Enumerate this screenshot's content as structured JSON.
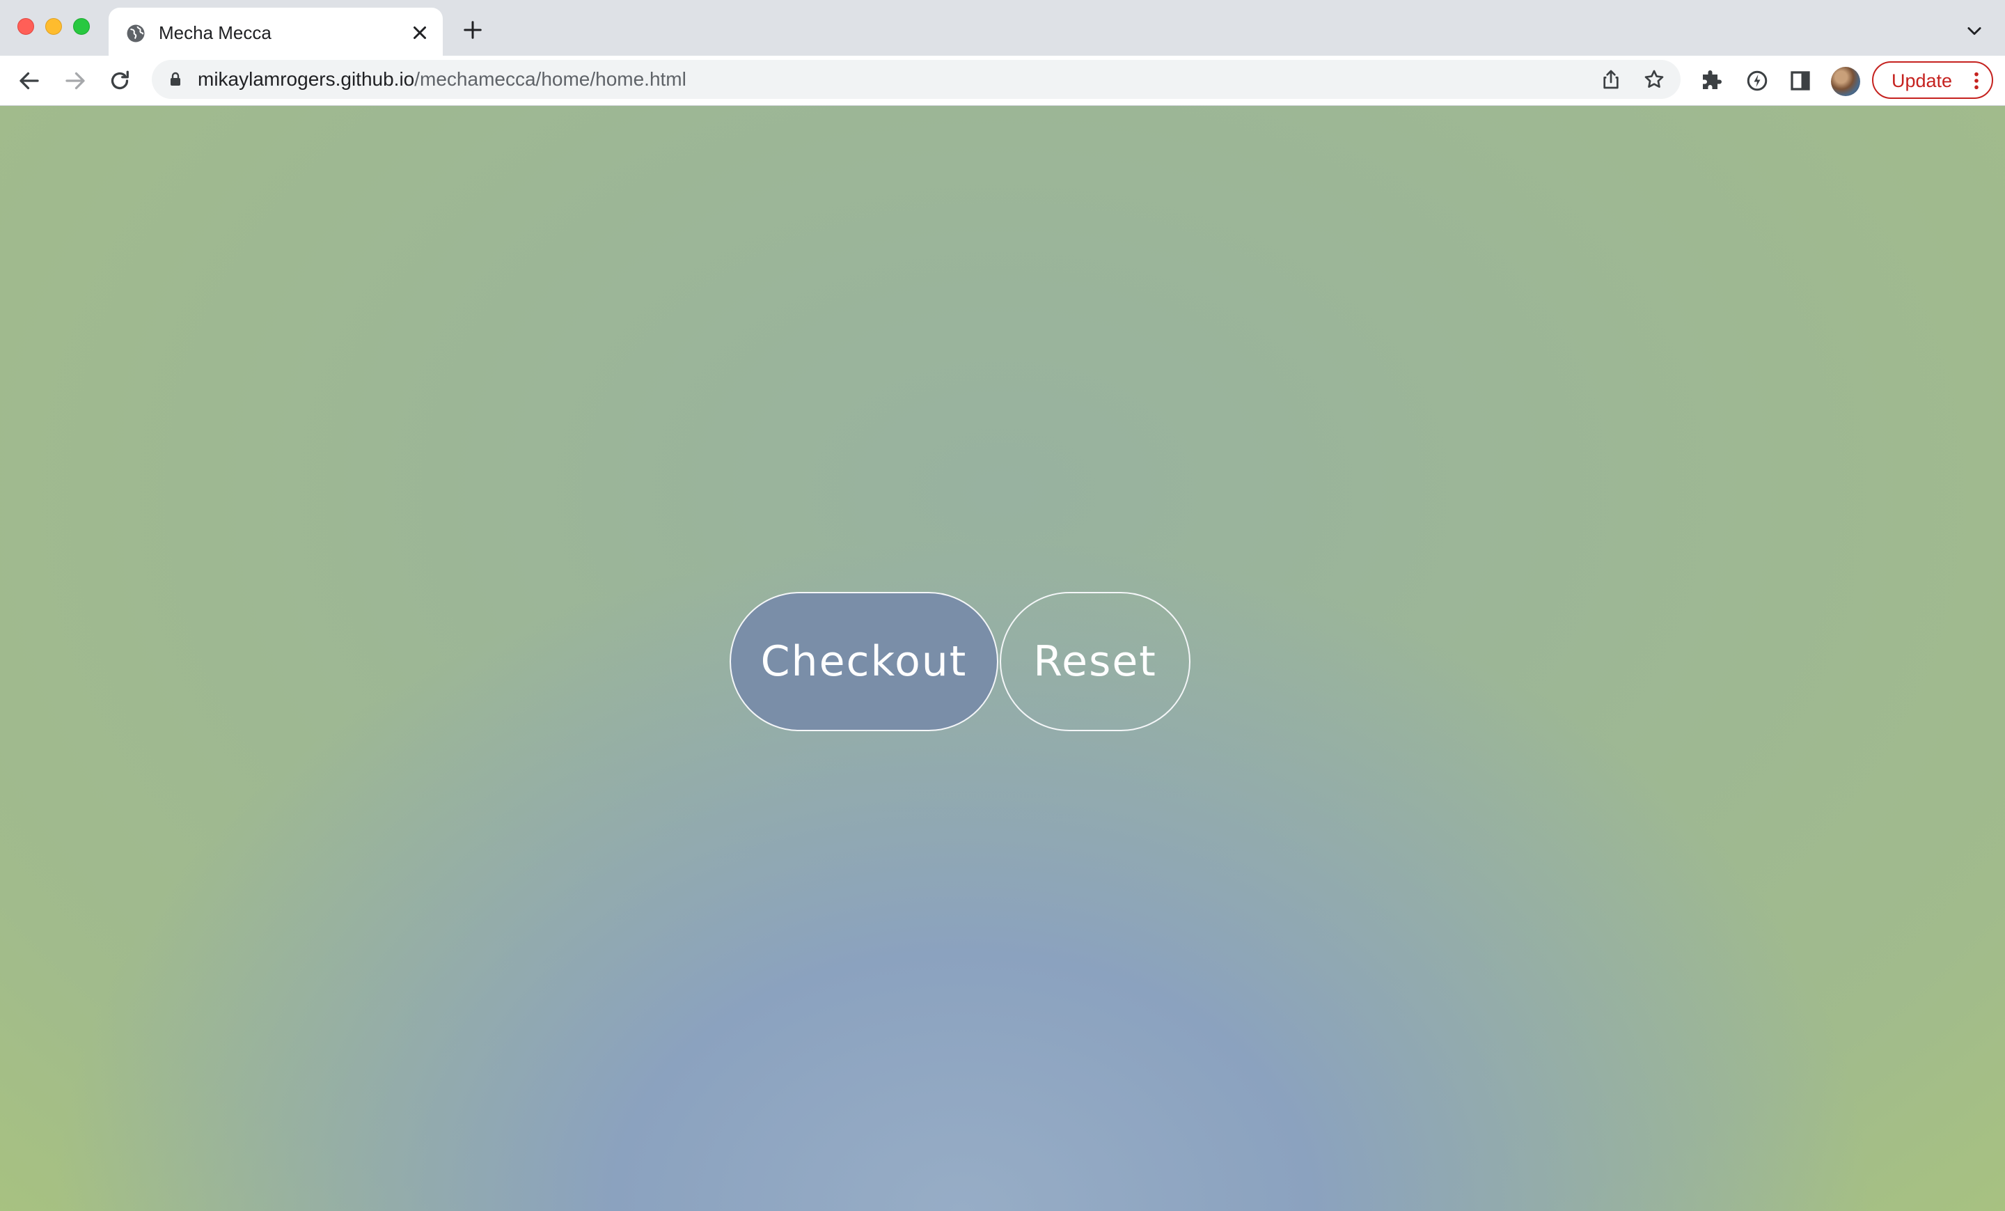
{
  "browser": {
    "tab": {
      "title": "Mecha Mecca"
    },
    "address_bar": {
      "host": "mikaylamrogers.github.io",
      "path": "/mechamecca/home/home.html"
    },
    "update_button": {
      "label": "Update",
      "color": "#c5221f"
    }
  },
  "page": {
    "buttons": {
      "checkout": "Checkout",
      "reset": "Reset"
    },
    "colors": {
      "checkout_fill": "#7a8ea8",
      "button_outline": "#f4f6f8",
      "gradient_center": "#97adc6",
      "gradient_edge": "#bcd75c"
    }
  }
}
